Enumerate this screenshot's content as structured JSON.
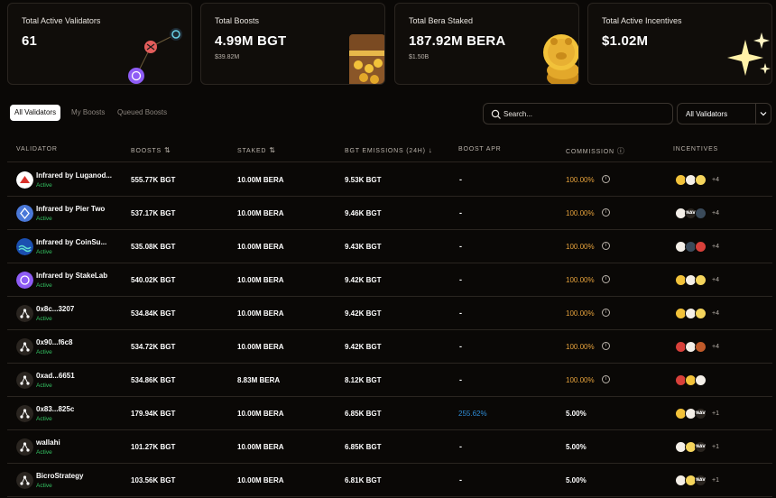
{
  "cards": [
    {
      "label": "Total Active Validators",
      "value": "61",
      "sub": ""
    },
    {
      "label": "Total Boosts",
      "value": "4.99M BGT",
      "sub": "$39.82M"
    },
    {
      "label": "Total Bera Staked",
      "value": "187.92M BERA",
      "sub": "$1.50B"
    },
    {
      "label": "Total Active Incentives",
      "value": "$1.02M",
      "sub": ""
    }
  ],
  "tabs": [
    {
      "label": "All Validators",
      "active": true
    },
    {
      "label": "My Boosts",
      "active": false
    },
    {
      "label": "Queued Boosts",
      "active": false
    }
  ],
  "search": {
    "placeholder": "Search..."
  },
  "filter_select": {
    "value": "All Validators"
  },
  "columns": {
    "validator": "VALIDATOR",
    "boosts": "BOOSTS",
    "staked": "STAKED",
    "emissions": "BGT EMISSIONS (24H)",
    "apr": "BOOST APR",
    "commission": "COMMISSION",
    "incentives": "INCENTIVES"
  },
  "sort_icons": {
    "boosts": "sort-arrows-icon",
    "staked": "sort-arrows-icon",
    "emissions": "sort-desc-icon"
  },
  "colors": {
    "active_green": "#34c463",
    "commission_orange": "#e6a23c",
    "apr_blue": "#2e8cd6",
    "tab_active_bg": "#ffffff"
  },
  "rows": [
    {
      "name": "Infrared by Luganod...",
      "status": "Active",
      "icon": "luganodes-logo-icon",
      "boosts": "555.77K BGT",
      "staked": "10.00M BERA",
      "emissions": "9.53K BGT",
      "apr": "-",
      "commission": "100.00%",
      "commission_color": "orange",
      "more": "+4",
      "tokens": [
        "bear-token-icon",
        "face-token-icon",
        "yellow-token-icon"
      ]
    },
    {
      "name": "Infrared by Pier Two",
      "status": "Active",
      "icon": "pier-two-logo-icon",
      "boosts": "537.17K BGT",
      "staked": "10.00M BERA",
      "emissions": "9.46K BGT",
      "apr": "-",
      "commission": "100.00%",
      "commission_color": "orange",
      "more": "+4",
      "tokens": [
        "face-token-icon",
        "nav-token-icon",
        "headphones-token-icon"
      ]
    },
    {
      "name": "Infrared by CoinSu...",
      "status": "Active",
      "icon": "coinsummer-logo-icon",
      "boosts": "535.08K BGT",
      "staked": "10.00M BERA",
      "emissions": "9.43K BGT",
      "apr": "-",
      "commission": "100.00%",
      "commission_color": "orange",
      "more": "+4",
      "tokens": [
        "face-token-icon",
        "headphones-token-icon",
        "red-token-icon"
      ]
    },
    {
      "name": "Infrared by StakeLab",
      "status": "Active",
      "icon": "stakelab-logo-icon",
      "boosts": "540.02K BGT",
      "staked": "10.00M BERA",
      "emissions": "9.42K BGT",
      "apr": "-",
      "commission": "100.00%",
      "commission_color": "orange",
      "more": "+4",
      "tokens": [
        "bear-token-icon",
        "face-token-icon",
        "yellow-token-icon"
      ]
    },
    {
      "name": "0x8c...3207",
      "status": "Active",
      "icon": "node-icon",
      "boosts": "534.84K BGT",
      "staked": "10.00M BERA",
      "emissions": "9.42K BGT",
      "apr": "-",
      "commission": "100.00%",
      "commission_color": "orange",
      "more": "+4",
      "tokens": [
        "bear-token-icon",
        "face-token-icon",
        "yellow-token-icon"
      ]
    },
    {
      "name": "0x90...f6c8",
      "status": "Active",
      "icon": "node-icon",
      "boosts": "534.72K BGT",
      "staked": "10.00M BERA",
      "emissions": "9.42K BGT",
      "apr": "-",
      "commission": "100.00%",
      "commission_color": "orange",
      "more": "+4",
      "tokens": [
        "red-token-icon",
        "face-token-icon",
        "stack-token-icon"
      ]
    },
    {
      "name": "0xad...6651",
      "status": "Active",
      "icon": "node-icon",
      "boosts": "534.86K BGT",
      "staked": "8.83M BERA",
      "emissions": "8.12K BGT",
      "apr": "-",
      "commission": "100.00%",
      "commission_color": "orange",
      "more": "",
      "tokens": [
        "red-token-icon",
        "bear-token-icon",
        "face-token-icon"
      ]
    },
    {
      "name": "0x83...825c",
      "status": "Active",
      "icon": "node-icon",
      "boosts": "179.94K BGT",
      "staked": "10.00M BERA",
      "emissions": "6.85K BGT",
      "apr": "255.62%",
      "commission": "5.00%",
      "commission_color": "white",
      "more": "+1",
      "tokens": [
        "bear-token-icon",
        "face-token-icon",
        "nav-token-icon"
      ]
    },
    {
      "name": "wallahi",
      "status": "Active",
      "icon": "node-icon",
      "boosts": "101.27K BGT",
      "staked": "10.00M BERA",
      "emissions": "6.85K BGT",
      "apr": "-",
      "commission": "5.00%",
      "commission_color": "white",
      "more": "+1",
      "tokens": [
        "face-token-icon",
        "yellow-token-icon",
        "nav-token-icon"
      ]
    },
    {
      "name": "BicroStrategy",
      "status": "Active",
      "icon": "node-icon",
      "boosts": "103.56K BGT",
      "staked": "10.00M BERA",
      "emissions": "6.81K BGT",
      "apr": "-",
      "commission": "5.00%",
      "commission_color": "white",
      "more": "+1",
      "tokens": [
        "face-token-icon",
        "yellow-token-icon",
        "nav-token-icon"
      ]
    }
  ],
  "nav_token_text": "NAV"
}
